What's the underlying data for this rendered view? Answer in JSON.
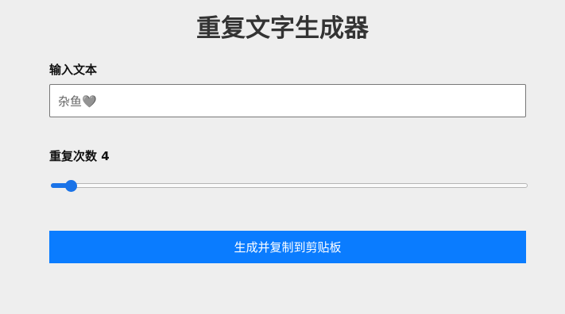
{
  "header": {
    "title": "重复文字生成器"
  },
  "text_section": {
    "label": "输入文本",
    "input_value": "杂鱼🩶"
  },
  "repeat_section": {
    "label_prefix": "重复次数",
    "count": "4",
    "slider": {
      "min": 1,
      "max": 100,
      "value": 4
    }
  },
  "action": {
    "button_label": "生成并复制到剪贴板"
  },
  "colors": {
    "accent": "#0a7cff",
    "slider_accent": "#1a73e8",
    "background": "#eeeeee"
  }
}
